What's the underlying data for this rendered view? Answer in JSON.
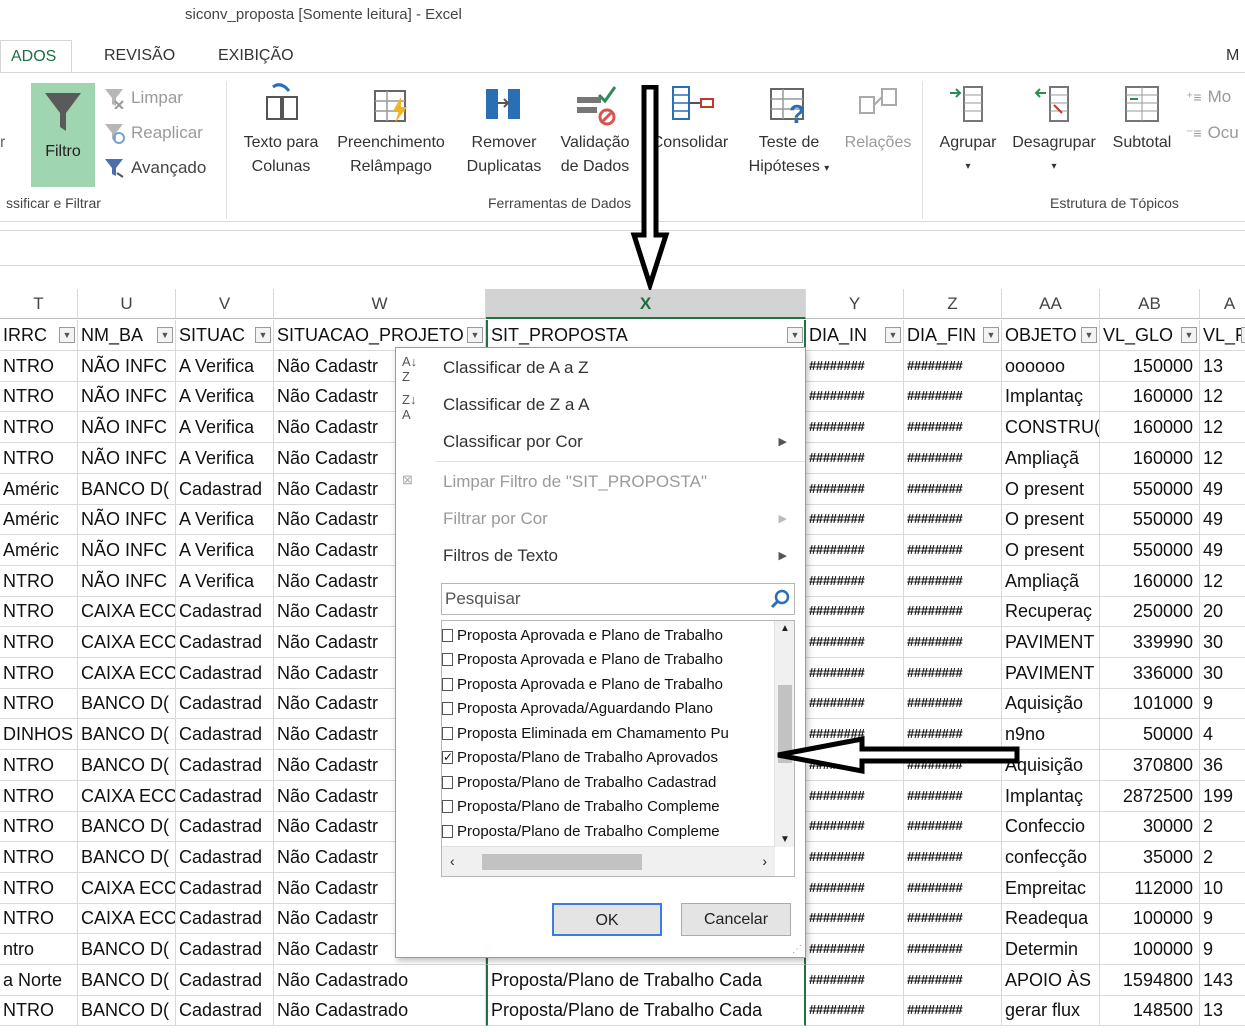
{
  "window": {
    "title": "siconv_proposta  [Somente leitura] - Excel"
  },
  "tabs": [
    {
      "label": "ADOS",
      "active": true
    },
    {
      "label": "REVISÃO",
      "active": false
    },
    {
      "label": "EXIBIÇÃO",
      "active": false
    },
    {
      "label": "M",
      "active": false
    }
  ],
  "ribbon": {
    "sort_filter": {
      "filtro": "Filtro",
      "limpar": "Limpar",
      "reaplicar": "Reaplicar",
      "avancado": "Avançado",
      "group_label": "ssificar e Filtrar"
    },
    "data_tools": {
      "texto_colunas_1": "Texto para",
      "texto_colunas_2": "Colunas",
      "preenchimento_1": "Preenchimento",
      "preenchimento_2": "Relâmpago",
      "remover_1": "Remover",
      "remover_2": "Duplicatas",
      "validacao_1": "Validação",
      "validacao_2": "de Dados",
      "consolidar": "Consolidar",
      "teste_1": "Teste de",
      "teste_2": "Hipóteses",
      "relacoes": "Relações",
      "group_label": "Ferramentas de Dados"
    },
    "outline": {
      "agrupar": "Agrupar",
      "desagrupar": "Desagrupar",
      "subtotal": "Subtotal",
      "mostrar": "Mo",
      "ocultar": "Ocu",
      "group_label": "Estrutura de Tópicos"
    }
  },
  "columns": [
    "T",
    "U",
    "V",
    "W",
    "X",
    "Y",
    "Z",
    "AA",
    "AB",
    "A"
  ],
  "header_row": [
    "IRRC",
    "NM_BA",
    "SITUAC",
    "SITUACAO_PROJETO",
    "SIT_PROPOSTA",
    "DIA_IN",
    "DIA_FIN",
    "OBJETO",
    "VL_GLO",
    "VL_F"
  ],
  "rows": [
    [
      "NTRO",
      "NÃO INFC",
      "A Verifica",
      "Não Cadastr",
      "",
      "########",
      "########",
      "oooooo",
      "150000",
      "13"
    ],
    [
      "NTRO",
      "NÃO INFC",
      "A Verifica",
      "Não Cadastr",
      "",
      "########",
      "########",
      "Implantaç",
      "160000",
      "12"
    ],
    [
      "NTRO",
      "NÃO INFC",
      "A Verifica",
      "Não Cadastr",
      "",
      "########",
      "########",
      "CONSTRU(",
      "160000",
      "12"
    ],
    [
      "NTRO",
      "NÃO INFC",
      "A Verifica",
      "Não Cadastr",
      "",
      "########",
      "########",
      "Ampliaçã",
      "160000",
      "12"
    ],
    [
      "Améric",
      "BANCO D(",
      "Cadastrad",
      "Não Cadastr",
      "",
      "########",
      "########",
      "O present",
      "550000",
      "49"
    ],
    [
      "Améric",
      "NÃO INFC",
      "A Verifica",
      "Não Cadastr",
      "",
      "########",
      "########",
      "O present",
      "550000",
      "49"
    ],
    [
      "Améric",
      "NÃO INFC",
      "A Verifica",
      "Não Cadastr",
      "",
      "########",
      "########",
      "O present",
      "550000",
      "49"
    ],
    [
      "NTRO",
      "NÃO INFC",
      "A Verifica",
      "Não Cadastr",
      "",
      "########",
      "########",
      "Ampliaçã",
      "160000",
      "12"
    ],
    [
      "NTRO",
      "CAIXA ECC",
      "Cadastrad",
      "Não Cadastr",
      "",
      "########",
      "########",
      "Recuperaç",
      "250000",
      "20"
    ],
    [
      "NTRO",
      "CAIXA ECC",
      "Cadastrad",
      "Não Cadastr",
      "",
      "########",
      "########",
      "PAVIMENT",
      "339990",
      "30"
    ],
    [
      "NTRO",
      "CAIXA ECC",
      "Cadastrad",
      "Não Cadastr",
      "",
      "########",
      "########",
      "PAVIMENT",
      "336000",
      "30"
    ],
    [
      "NTRO",
      "BANCO D(",
      "Cadastrad",
      "Não Cadastr",
      "",
      "########",
      "########",
      "Aquisição",
      "101000",
      "9"
    ],
    [
      "DINHOS",
      "BANCO D(",
      "Cadastrad",
      "Não Cadastr",
      "",
      "########",
      "########",
      "n9no",
      "50000",
      "4"
    ],
    [
      "NTRO",
      "BANCO D(",
      "Cadastrad",
      "Não Cadastr",
      "",
      "########",
      "########",
      "Aquisição",
      "370800",
      "36"
    ],
    [
      "NTRO",
      "CAIXA ECC",
      "Cadastrad",
      "Não Cadastr",
      "",
      "########",
      "########",
      "Implantaç",
      "2872500",
      "199"
    ],
    [
      "NTRO",
      "BANCO D(",
      "Cadastrad",
      "Não Cadastr",
      "",
      "########",
      "########",
      "Confeccio",
      "30000",
      "2"
    ],
    [
      "NTRO",
      "BANCO D(",
      "Cadastrad",
      "Não Cadastr",
      "",
      "########",
      "########",
      "confecção",
      "35000",
      "2"
    ],
    [
      "NTRO",
      "CAIXA ECC",
      "Cadastrad",
      "Não Cadastr",
      "",
      "########",
      "########",
      "Empreitac",
      "112000",
      "10"
    ],
    [
      "NTRO",
      "CAIXA ECC",
      "Cadastrad",
      "Não Cadastr",
      "",
      "########",
      "########",
      "Readequa",
      "100000",
      "9"
    ],
    [
      "ntro",
      "BANCO D(",
      "Cadastrad",
      "Não Cadastr",
      "",
      "########",
      "########",
      "Determin",
      "100000",
      "9"
    ],
    [
      "a Norte",
      "BANCO D(",
      "Cadastrad",
      "Não Cadastrado",
      "Proposta/Plano de Trabalho Cada",
      "########",
      "########",
      "APOIO ÀS",
      "1594800",
      "143"
    ],
    [
      "NTRO",
      "BANCO D(",
      "Cadastrad",
      "Não Cadastrado",
      "Proposta/Plano de Trabalho Cada",
      "########",
      "########",
      "gerar flux",
      "148500",
      "13"
    ]
  ],
  "filter_menu": {
    "sort_az": "Classificar de A a Z",
    "sort_za": "Classificar de Z a A",
    "sort_color": "Classificar por Cor",
    "clear_filter": "Limpar Filtro de \"SIT_PROPOSTA\"",
    "filter_color": "Filtrar por Cor",
    "text_filters": "Filtros de Texto",
    "search_placeholder": "Pesquisar",
    "items": [
      {
        "label": "Proposta Aprovada e Plano de Trabalho",
        "checked": false
      },
      {
        "label": "Proposta Aprovada e Plano de Trabalho",
        "checked": false
      },
      {
        "label": "Proposta Aprovada e Plano de Trabalho",
        "checked": false
      },
      {
        "label": "Proposta Aprovada/Aguardando Plano",
        "checked": false
      },
      {
        "label": "Proposta Eliminada em Chamamento Pu",
        "checked": false
      },
      {
        "label": "Proposta/Plano de Trabalho Aprovados",
        "checked": true
      },
      {
        "label": "Proposta/Plano de Trabalho Cadastrad",
        "checked": false
      },
      {
        "label": "Proposta/Plano de Trabalho Compleme",
        "checked": false
      },
      {
        "label": "Proposta/Plano de Trabalho Compleme",
        "checked": false
      }
    ],
    "ok": "OK",
    "cancel": "Cancelar"
  },
  "colors": {
    "excel_green": "#217346",
    "filter_active": "#9fd5b1",
    "ok_border": "#3b7ddd"
  }
}
